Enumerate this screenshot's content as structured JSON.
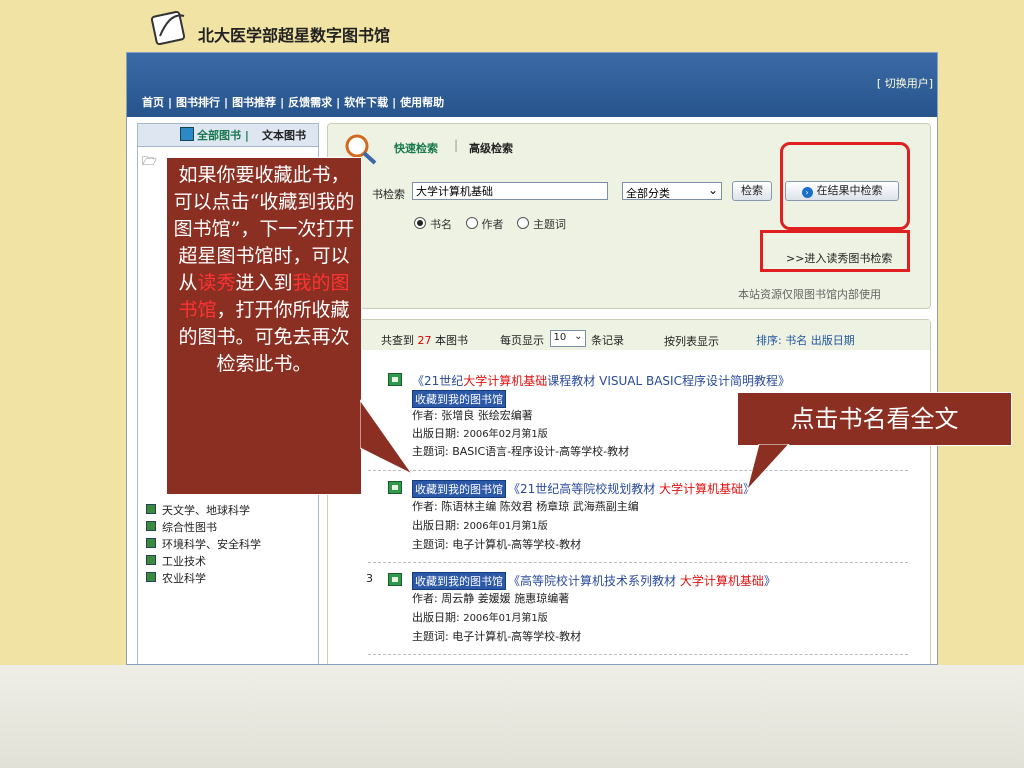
{
  "app": {
    "title": "北大医学部超星数字图书馆"
  },
  "topbar": {
    "switch_user": "[ 切换用户]",
    "nav": [
      "首页",
      "图书排行",
      "图书推荐",
      "反馈需求",
      "软件下载",
      "使用帮助"
    ],
    "nav_sep": "|"
  },
  "left_panel": {
    "tab_all": "全部图书",
    "tab_sep": "|",
    "tab_text": "文本图书",
    "categories": [
      "天文学、地球科学",
      "综合性图书",
      "环境科学、安全科学",
      "工业技术",
      "农业科学"
    ]
  },
  "search": {
    "tab_quick": "快速检索",
    "tab_sep": "|",
    "tab_advanced": "高级检索",
    "label": "书检索",
    "query": "大学计算机基础",
    "category_selected": "全部分类",
    "button_search": "检索",
    "button_within": "在结果中检索",
    "options": [
      "书名",
      "作者",
      "主题词"
    ],
    "selected_option": "书名",
    "excellent_link": ">>进入读秀图书检索",
    "note": "本站资源仅限图书馆内部使用"
  },
  "results_bar": {
    "count_prefix": "共查到",
    "count": "27",
    "count_suffix": "本图书",
    "per_page_label": "每页显示",
    "per_page_value": "10",
    "per_page_suffix": "条记录",
    "list_view": "按列表显示",
    "sort_label": "排序:",
    "sort_options": "书名 出版日期"
  },
  "results": [
    {
      "num": "",
      "fav_label": "收藏到我的图书馆",
      "title_pre": "《21世纪",
      "title_hl": "大学计算机基础",
      "title_post": "课程教材 VISUAL BASIC程序设计简明教程》",
      "author": "作者: 张增良 张绘宏编著",
      "date_label": "出版日期: ",
      "date": "2006年02月第1版",
      "subject": "主题词: BASIC语言-程序设计-高等学校-教材"
    },
    {
      "num": "",
      "fav_label": "收藏到我的图书馆",
      "title_pre": "《21世纪高等院校规划教材 ",
      "title_hl": "大学计算机基础",
      "title_post": "》",
      "author": "作者: 陈语林主编 陈效君 杨章琼 武海燕副主编",
      "date_label": "出版日期: ",
      "date": "2006年01月第1版",
      "subject": "主题词: 电子计算机-高等学校-教材"
    },
    {
      "num": "3",
      "fav_label": "收藏到我的图书馆",
      "title_pre": "《高等院校计算机技术系列教材 ",
      "title_hl": "大学计算机基础",
      "title_post": "》",
      "author": "作者: 周云静 姜媛媛 施惠琼编著",
      "date_label": "出版日期: ",
      "date": "2006年01月第1版",
      "subject": "主题词: 电子计算机-高等学校-教材"
    }
  ],
  "callouts": {
    "left_a": "如果你要收藏此书，可以点击“收藏到我的图书馆”，下一次打开超星图书馆时，可以从",
    "left_red1": "读秀",
    "left_b": "进入到",
    "left_red2": "我的图书馆",
    "left_c": "，打开你所收藏的图书。可免去再次检索此书。",
    "right": "点击书名看全文"
  },
  "colors": {
    "callout_bg": "#8b2f22",
    "highlight_red": "#e01010",
    "link_blue": "#2a4a9a",
    "header_blue": "#2e5c98"
  }
}
